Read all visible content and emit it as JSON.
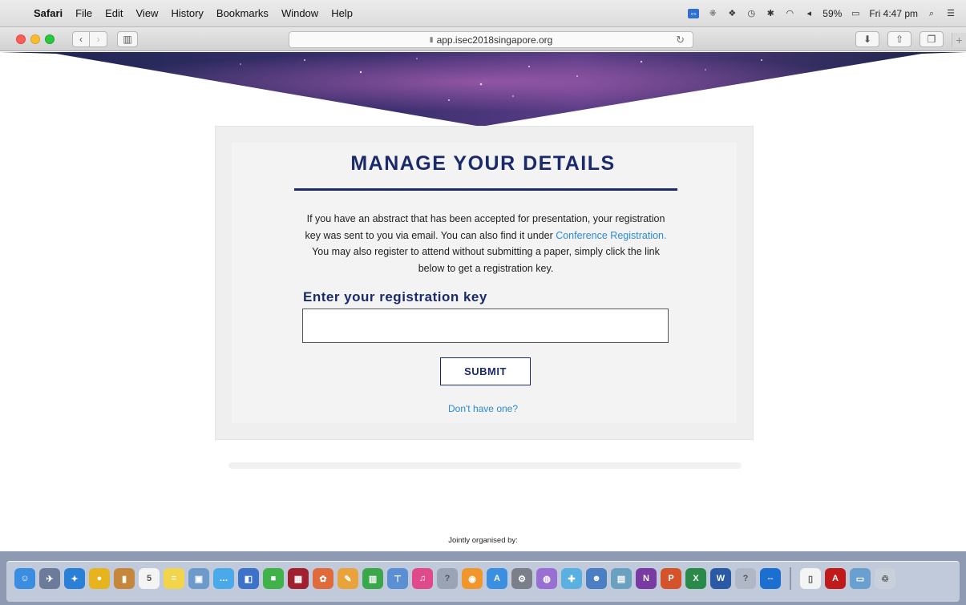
{
  "menubar": {
    "app_name": "Safari",
    "menus": [
      "File",
      "Edit",
      "View",
      "History",
      "Bookmarks",
      "Window",
      "Help"
    ],
    "battery": "59%",
    "clock": "Fri 4:47 pm"
  },
  "browser": {
    "url": "app.isec2018singapore.org"
  },
  "page": {
    "title": "MANAGE YOUR DETAILS",
    "description_part1": "If you have an abstract that has been accepted for presentation, your registration key was sent to you via email. You can also find it under ",
    "description_link": "Conference Registration.",
    "description_part2": " You may also register to attend without submitting a paper, simply click the link below to get a registration key.",
    "key_label": "Enter your registration key",
    "key_value": "",
    "submit_label": "SUBMIT",
    "no_key_link": "Don't have one?",
    "footer_text": "Jointly organised by:"
  },
  "dock": {
    "icons": [
      {
        "name": "finder-icon",
        "color": "#3a8de0",
        "glyph": "☺"
      },
      {
        "name": "launchpad-icon",
        "color": "#6b7b99",
        "glyph": "✈"
      },
      {
        "name": "safari-icon",
        "color": "#2a7fd6",
        "glyph": "✦"
      },
      {
        "name": "chrome-icon",
        "color": "#e8b41d",
        "glyph": "●"
      },
      {
        "name": "notefile-icon",
        "color": "#c7873b",
        "glyph": "▮"
      },
      {
        "name": "calendar-icon",
        "color": "#f4f4f4",
        "glyph": "5"
      },
      {
        "name": "notes-icon",
        "color": "#f2d54a",
        "glyph": "≡"
      },
      {
        "name": "preview-icon",
        "color": "#6c9bcb",
        "glyph": "▣"
      },
      {
        "name": "messages-icon",
        "color": "#4aa9e9",
        "glyph": "…"
      },
      {
        "name": "keynote-icon",
        "color": "#3c73c9",
        "glyph": "◧"
      },
      {
        "name": "facetime-icon",
        "color": "#3fb34a",
        "glyph": "■"
      },
      {
        "name": "photobooth-icon",
        "color": "#a02030",
        "glyph": "▦"
      },
      {
        "name": "photos-icon",
        "color": "#e06a3a",
        "glyph": "✿"
      },
      {
        "name": "pages-icon",
        "color": "#e9a33a",
        "glyph": "✎"
      },
      {
        "name": "numbers-icon",
        "color": "#3aa84a",
        "glyph": "▥"
      },
      {
        "name": "keynote-stand-icon",
        "color": "#5b8fd4",
        "glyph": "⊤"
      },
      {
        "name": "itunes-icon",
        "color": "#e04a8a",
        "glyph": "♫"
      },
      {
        "name": "help-icon",
        "color": "#9aa4b5",
        "glyph": "?"
      },
      {
        "name": "ibooks-icon",
        "color": "#f0962a",
        "glyph": "◉"
      },
      {
        "name": "appstore-icon",
        "color": "#3a8fe0",
        "glyph": "A"
      },
      {
        "name": "sysprefs-icon",
        "color": "#7a7f8a",
        "glyph": "⚙"
      },
      {
        "name": "siri-icon",
        "color": "#9a6fd4",
        "glyph": "◍"
      },
      {
        "name": "maps-icon",
        "color": "#5ab0e0",
        "glyph": "✚"
      },
      {
        "name": "contacts-icon",
        "color": "#4a7fc4",
        "glyph": "☻"
      },
      {
        "name": "gallery-icon",
        "color": "#6aa0c0",
        "glyph": "▤"
      },
      {
        "name": "onenote-icon",
        "color": "#7a3aa4",
        "glyph": "N"
      },
      {
        "name": "powerpoint-icon",
        "color": "#d4532a",
        "glyph": "P"
      },
      {
        "name": "excel-icon",
        "color": "#2a8a4a",
        "glyph": "X"
      },
      {
        "name": "word-icon",
        "color": "#2a5aa4",
        "glyph": "W"
      },
      {
        "name": "question-icon",
        "color": "#b0b8c8",
        "glyph": "?"
      },
      {
        "name": "teamviewer-icon",
        "color": "#1a6fd0",
        "glyph": "⇔"
      }
    ],
    "right_icons": [
      {
        "name": "document-icon",
        "color": "#f4f4f4",
        "glyph": "▯"
      },
      {
        "name": "acrobat-icon",
        "color": "#c01a1a",
        "glyph": "A"
      },
      {
        "name": "downloads-icon",
        "color": "#6aa0d0",
        "glyph": "▭"
      },
      {
        "name": "trash-icon",
        "color": "#c8d0dc",
        "glyph": "♲"
      }
    ]
  }
}
